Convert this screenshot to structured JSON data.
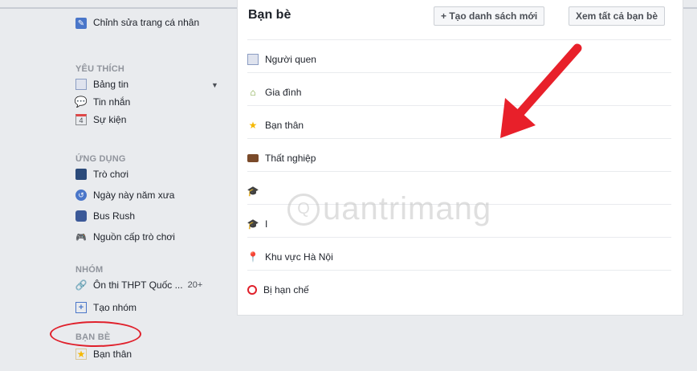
{
  "sidebar": {
    "edit_profile": "Chỉnh sửa trang cá nhân",
    "favorites_header": "YÊU THÍCH",
    "favorites": [
      "Bảng tin",
      "Tin nhắn",
      "Sự kiện"
    ],
    "events_icon_number": "4",
    "apps_header": "ỨNG DỤNG",
    "apps": [
      "Trò chơi",
      "Ngày này năm xưa",
      "Bus Rush",
      "Nguồn cấp trò chơi"
    ],
    "groups_header": "NHÓM",
    "groups": [
      {
        "label": "Ôn thi THPT Quốc ...",
        "count": "20+"
      }
    ],
    "create_group": "Tạo nhóm",
    "friends_header": "BẠN BÈ",
    "friends": [
      "Bạn thân"
    ]
  },
  "panel": {
    "title": "Bạn bè",
    "create_list_button": "+ Tạo danh sách mới",
    "see_all_button": "Xem tất cả bạn bè",
    "lists": [
      {
        "label": "Người quen",
        "icon": "acquaintances-icon"
      },
      {
        "label": "Gia đình",
        "icon": "family-icon"
      },
      {
        "label": "Bạn thân",
        "icon": "close-friends-icon"
      },
      {
        "label": "Thất nghiệp",
        "icon": "work-icon"
      },
      {
        "label": "",
        "icon": "school-icon"
      },
      {
        "label": "I",
        "icon": "school-icon"
      },
      {
        "label": "Khu vực Hà Nội",
        "icon": "location-icon"
      },
      {
        "label": "Bị hạn chế",
        "icon": "restricted-icon"
      }
    ]
  },
  "watermark": {
    "text": "uantrimang",
    "letter": "Q"
  },
  "colors": {
    "arrow": "#e8202a",
    "annotation_oval": "#e0202b",
    "header_gray": "#90949c"
  }
}
